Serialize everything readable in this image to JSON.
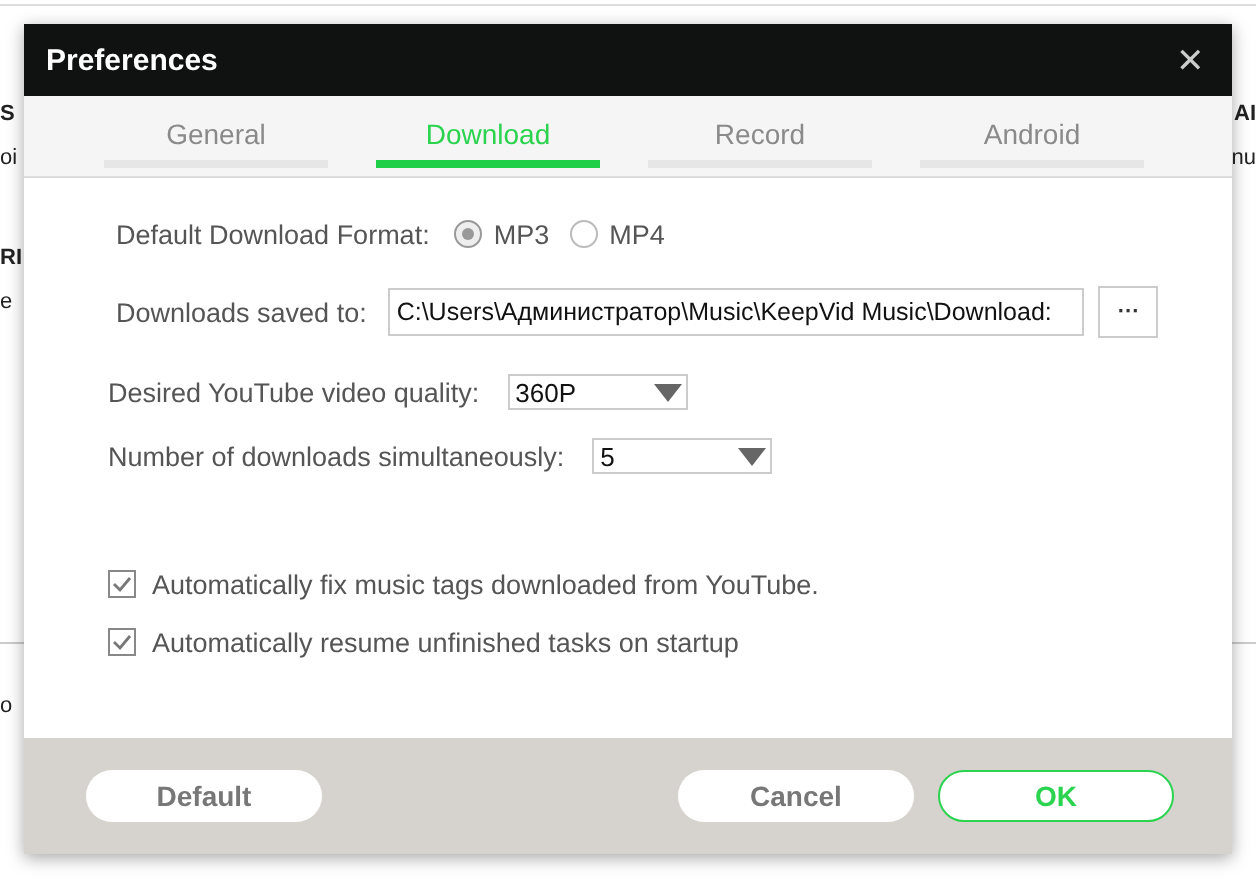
{
  "background_left": [
    {
      "text": "S",
      "bold": true
    },
    {
      "text": "oi",
      "bold": false
    },
    {
      "text": "RI",
      "bold": true
    },
    {
      "text": "e",
      "bold": false
    },
    {
      "text": "o",
      "bold": false
    }
  ],
  "background_right": [
    {
      "text": "AI",
      "bold": true
    },
    {
      "text": "nu",
      "bold": false
    }
  ],
  "window": {
    "title": "Preferences",
    "close": "✕"
  },
  "tabs": [
    {
      "label": "General",
      "selected": false
    },
    {
      "label": "Download",
      "selected": true
    },
    {
      "label": "Record",
      "selected": false
    },
    {
      "label": "Android",
      "selected": false
    }
  ],
  "format": {
    "label": "Default Download Format:",
    "options": [
      {
        "label": "MP3",
        "selected": true
      },
      {
        "label": "MP4",
        "selected": false
      }
    ]
  },
  "save_path": {
    "label": "Downloads saved to:",
    "value": "C:\\Users\\Администратор\\Music\\KeepVid Music\\Download:",
    "browse": "···"
  },
  "quality": {
    "label": "Desired YouTube video quality:",
    "value": "360P"
  },
  "simultaneous": {
    "label": "Number of downloads simultaneously:",
    "value": "5"
  },
  "checkboxes": [
    {
      "label": "Automatically fix music tags downloaded from YouTube.",
      "checked": true
    },
    {
      "label": "Automatically resume unfinished tasks on startup",
      "checked": true
    }
  ],
  "buttons": [
    {
      "label": "Default",
      "kind": "plain"
    },
    {
      "label": "Cancel",
      "kind": "plain"
    },
    {
      "label": "OK",
      "kind": "primary"
    }
  ]
}
